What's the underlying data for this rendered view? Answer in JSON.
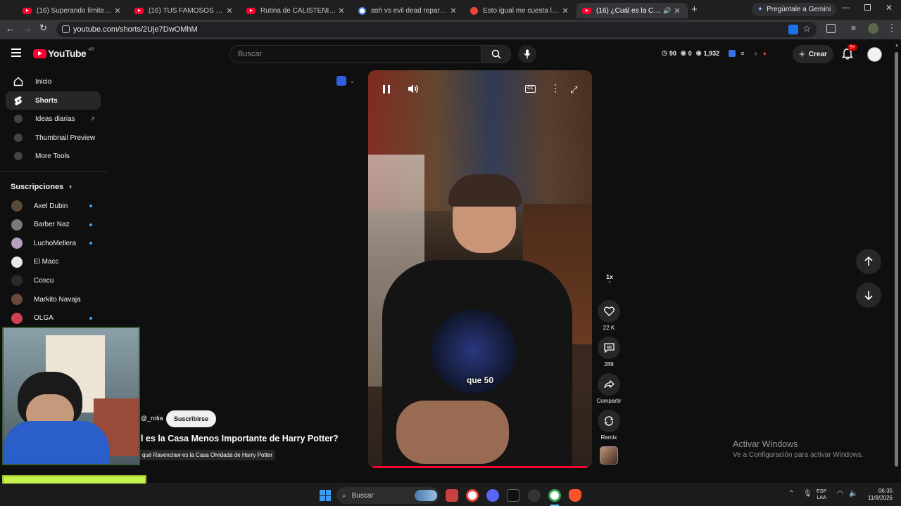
{
  "browser": {
    "tabs": [
      {
        "title": "(16) Superando límites: Día 22...",
        "icon": "youtube-icon"
      },
      {
        "title": "(16) TUS FAMOSOS FAVORITOS...",
        "icon": "youtube-icon"
      },
      {
        "title": "Rutina de CALISTENIA en Casa...",
        "icon": "youtube-icon"
      },
      {
        "title": "ash vs evil dead reparto - Busca...",
        "icon": "google-icon"
      },
      {
        "title": "Esto igual me cuesta la vida, pe...",
        "icon": "reddit-icon"
      },
      {
        "title": "(16) ¿Cuál es la Casa Menos...",
        "icon": "youtube-icon",
        "active": true
      }
    ],
    "gemini_label": "Pregúntale a Gemini",
    "url": "youtube.com/shorts/2Uje7DwOMhM"
  },
  "youtube": {
    "logo": "YouTube",
    "region": "AR",
    "search_placeholder": "Buscar",
    "ext_stats": {
      "comments": "90",
      "zero": "0",
      "views": "1,932"
    },
    "create_label": "Crear",
    "notif_badge": "9+",
    "sidebar": {
      "items": [
        {
          "label": "Inicio",
          "icon": "home-icon"
        },
        {
          "label": "Shorts",
          "icon": "shorts-icon",
          "active": true
        },
        {
          "label": "Ideas diarias",
          "icon": "ext-icon"
        },
        {
          "label": "Thumbnail Preview",
          "icon": "ext-icon"
        },
        {
          "label": "More Tools",
          "icon": "ext-icon"
        }
      ],
      "subs_header": "Suscripciones",
      "subs": [
        {
          "name": "Axel Dubin",
          "color": "#5a4a3a",
          "dot": true
        },
        {
          "name": "Barber Naz",
          "color": "#7a7a7a",
          "dot": true
        },
        {
          "name": "LuchoMellera",
          "color": "#b8a0c0",
          "dot": true
        },
        {
          "name": "El Macc",
          "color": "#e8e8e8",
          "dot": false
        },
        {
          "name": "Coscu",
          "color": "#2a2a2a",
          "dot": false
        },
        {
          "name": "Markito Navaja",
          "color": "#6a4a3a",
          "dot": false
        },
        {
          "name": "OLGA",
          "color": "#d04050",
          "dot": true
        }
      ]
    },
    "short": {
      "channel": "@_rotia",
      "subscribe_label": "Suscribirse",
      "title": "l es la Casa Menos Importante de Harry Potter?",
      "subtitle": "qué Ravenclaw es la Casa Olvidada de Harry Potter",
      "caption": "que 50",
      "speed": "1x",
      "likes": "22 K",
      "comments": "289",
      "share_label": "Compartir",
      "remix_label": "Remix"
    }
  },
  "overlay": {
    "watermark_title": "Activar Windows",
    "watermark_sub": "Ve a Configuración para activar Windows.",
    "streamer_tag": "@ROCKOFLOW90"
  },
  "taskbar": {
    "search_label": "Buscar",
    "lang_top": "ESP",
    "lang_bottom": "LAA",
    "time": "06:35",
    "date": "11/8/2026"
  }
}
